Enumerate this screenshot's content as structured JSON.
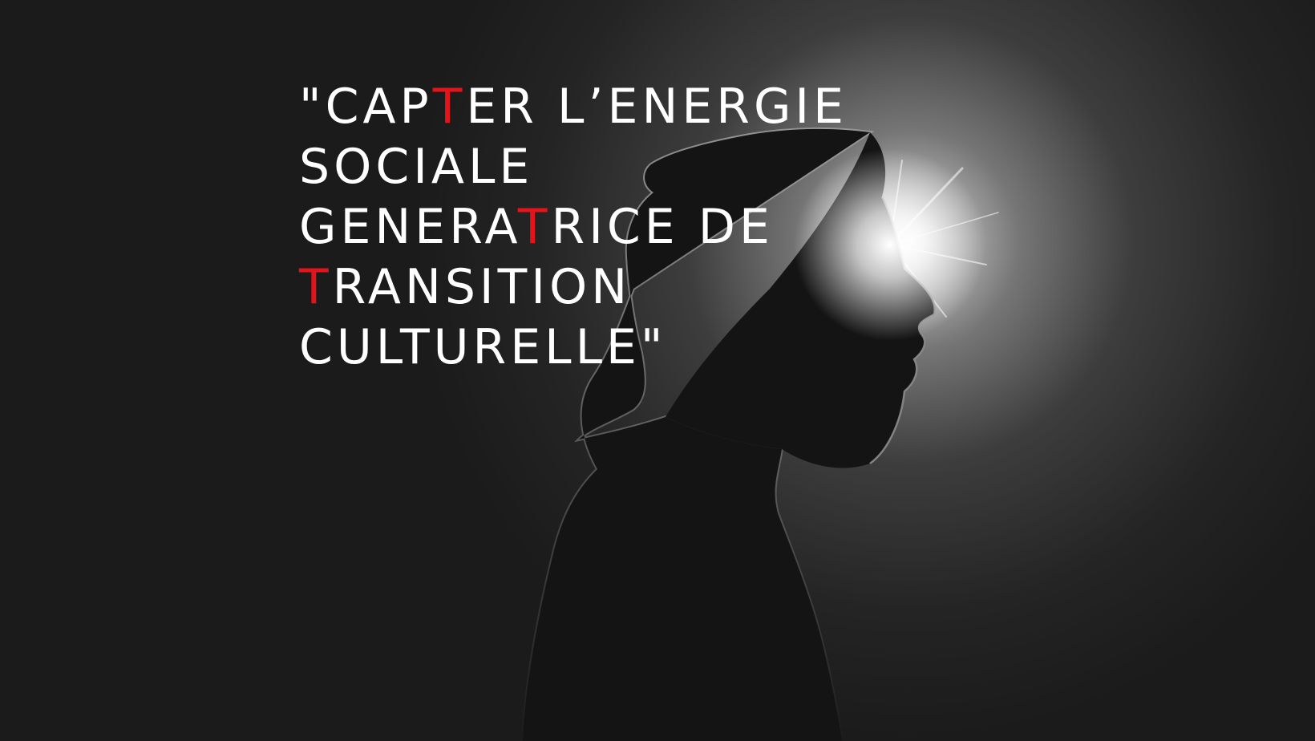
{
  "quote": {
    "lines": [
      {
        "before": "\"CAP",
        "accent": "T",
        "after": "ER L’ENERGIE"
      },
      {
        "before": "SOCIALE",
        "accent": "",
        "after": ""
      },
      {
        "before": "GENERA",
        "accent": "T",
        "after": "RICE DE"
      },
      {
        "before": "",
        "accent": "T",
        "after": "RANSITION"
      },
      {
        "before": "CULTURELLE\"",
        "accent": "",
        "after": ""
      }
    ],
    "accent_color": "#e3141a",
    "text_color": "#ffffff"
  },
  "scene": {
    "subject": "silhouette-profile-with-backlight",
    "background_color": "#1c1c1c",
    "light_color": "#ffffff"
  }
}
